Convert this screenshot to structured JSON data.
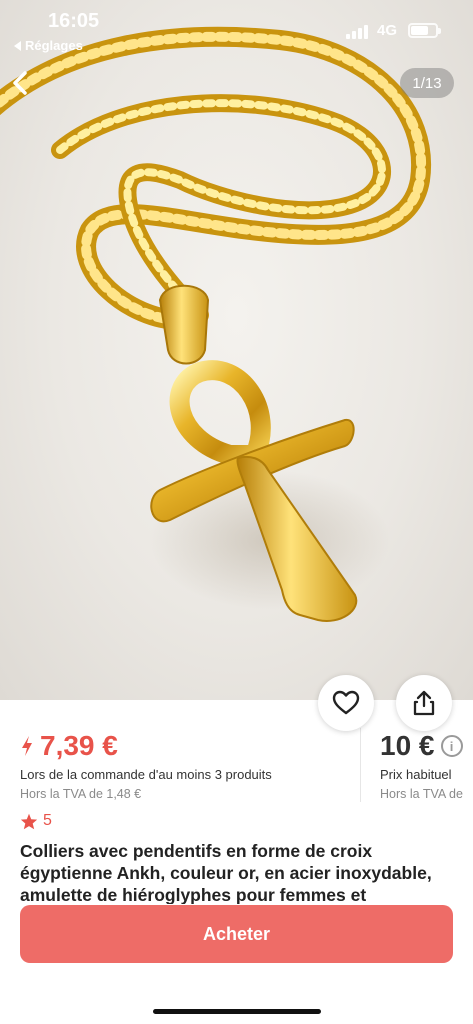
{
  "status_bar": {
    "time": "16:05",
    "back_app_label": "Réglages",
    "network": "4G"
  },
  "gallery": {
    "counter": "1/13"
  },
  "product": {
    "price": "7,39 €",
    "condition": "Lors de la commande d'au moins 3 produits",
    "vat_note": "Hors la TVA de 1,48 €",
    "regular_price": "10 €",
    "regular_label": "Prix habituel",
    "regular_vat": "Hors la TVA de",
    "rating": "5",
    "title": "Colliers avec pendentifs en forme de croix égyptienne Ankh, couleur or, en acier inoxydable, amulette de hiéroglyphes pour femmes et"
  },
  "actions": {
    "buy_label": "Acheter"
  },
  "colors": {
    "accent": "#e8534a",
    "button": "#ee6c67",
    "gold": "#d9a920"
  },
  "icons": [
    "chevron-left-icon",
    "heart-icon",
    "share-icon",
    "info-icon",
    "star-icon",
    "bolt-icon"
  ]
}
